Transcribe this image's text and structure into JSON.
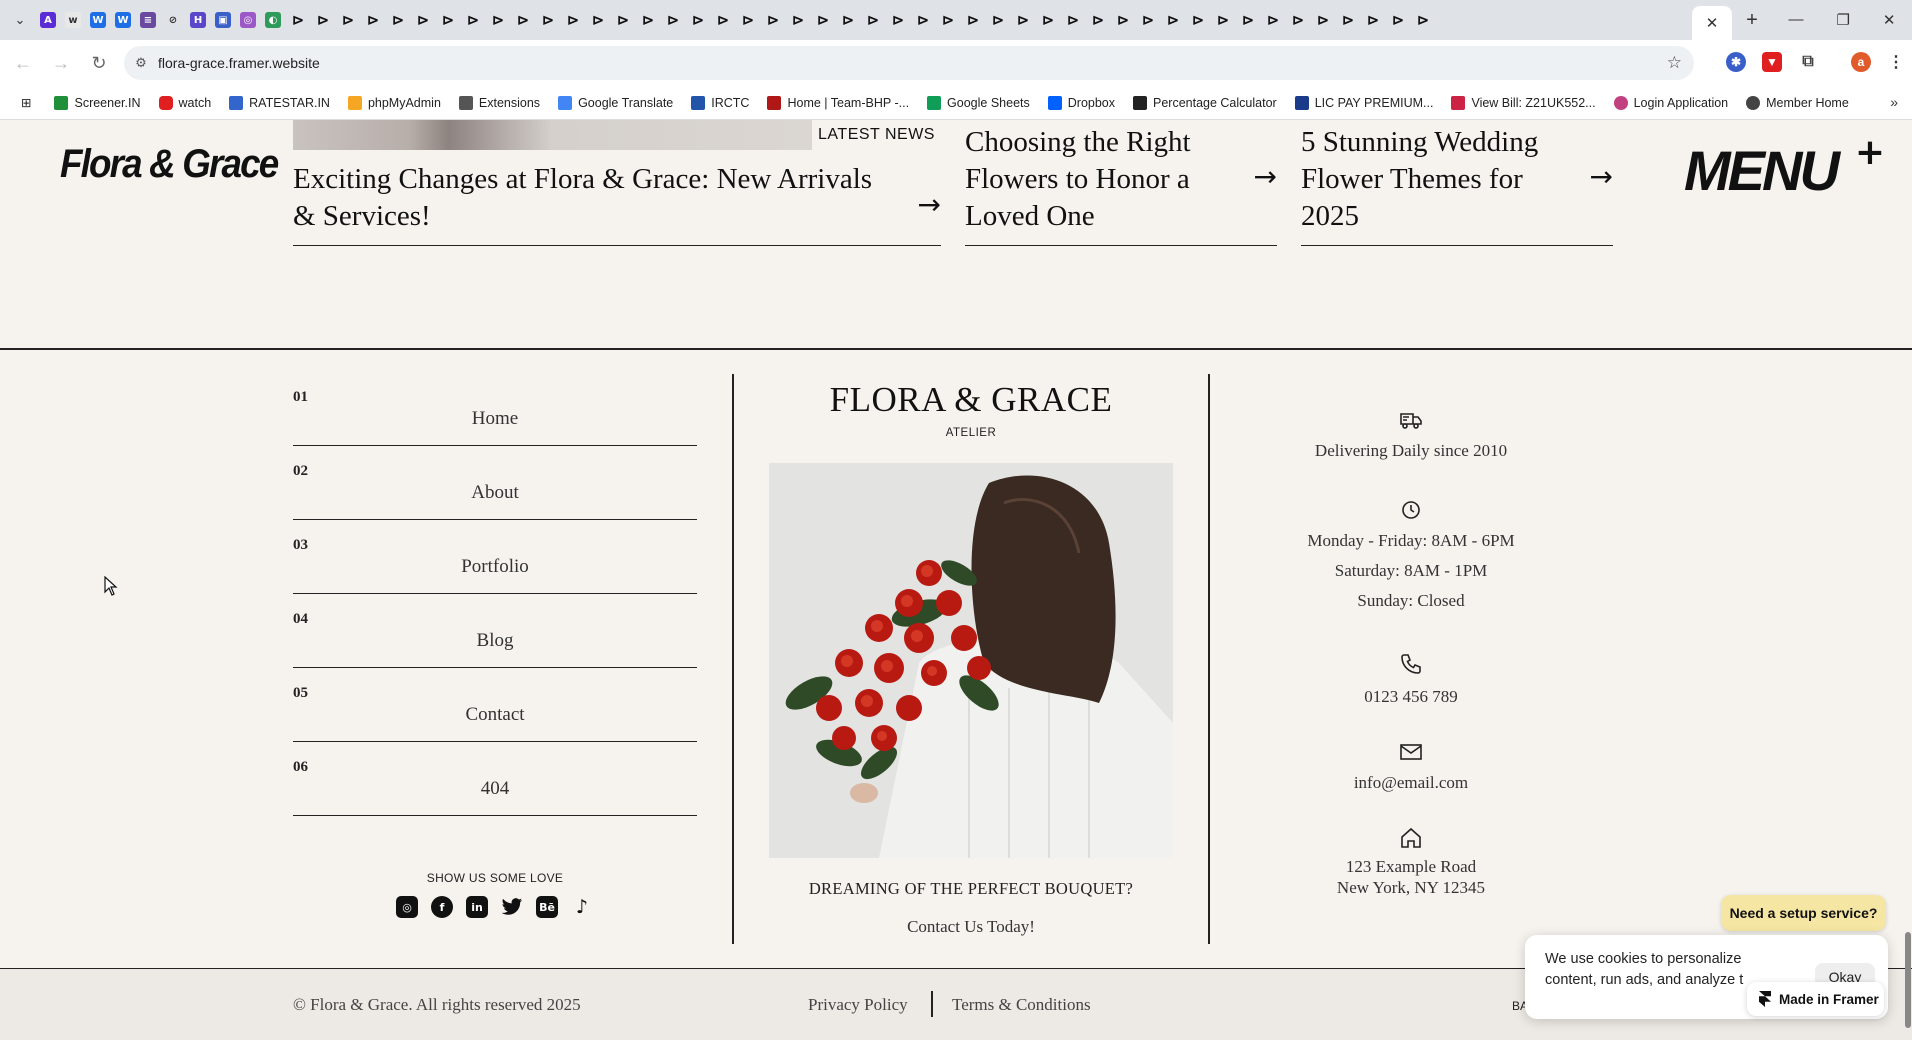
{
  "browser": {
    "active_tab_close": "✕",
    "new_tab": "+",
    "window_controls": [
      "—",
      "❐",
      "✕"
    ],
    "url": "flora-grace.framer.website",
    "profile_initial": "a",
    "bookmarks": [
      {
        "label": "Screener.IN",
        "color": "#1f8f3a"
      },
      {
        "label": "watch",
        "color": "#e02020"
      },
      {
        "label": "RATESTAR.IN",
        "color": "#3366cc"
      },
      {
        "label": "phpMyAdmin",
        "color": "#f5a623"
      },
      {
        "label": "Extensions",
        "color": "#555555"
      },
      {
        "label": "Google Translate",
        "color": "#4285f4"
      },
      {
        "label": "IRCTC",
        "color": "#2255aa"
      },
      {
        "label": "Home | Team-BHP -...",
        "color": "#b01818"
      },
      {
        "label": "Google Sheets",
        "color": "#0f9d58"
      },
      {
        "label": "Dropbox",
        "color": "#0061fe"
      },
      {
        "label": "Percentage Calculator",
        "color": "#222222"
      },
      {
        "label": "LIC PAY PREMIUM...",
        "color": "#1a3a8a"
      },
      {
        "label": "View Bill: Z21UK552...",
        "color": "#cc2244"
      },
      {
        "label": "Login Application",
        "color": "#c04080"
      },
      {
        "label": "Member Home",
        "color": "#444444"
      }
    ],
    "bookmarks_more": "»"
  },
  "header": {
    "logo": "Flora & Grace",
    "menu_label": "MENU",
    "menu_plus": "+"
  },
  "news": {
    "badge": "LATEST NEWS",
    "items": [
      {
        "title": "Exciting Changes at Flora & Grace: New Arrivals & Services!",
        "arrow": "→"
      },
      {
        "title": "Choosing the Right Flowers to Honor a Loved One",
        "arrow": "→"
      },
      {
        "title": "5 Stunning Wedding Flower Themes for 2025",
        "arrow": "→"
      }
    ]
  },
  "footer_nav": {
    "items": [
      {
        "num": "01",
        "label": "Home"
      },
      {
        "num": "02",
        "label": "About"
      },
      {
        "num": "03",
        "label": "Portfolio"
      },
      {
        "num": "04",
        "label": "Blog"
      },
      {
        "num": "05",
        "label": "Contact"
      },
      {
        "num": "06",
        "label": "404"
      }
    ],
    "social_title": "SHOW US SOME LOVE",
    "socials": [
      "instagram-icon",
      "facebook-icon",
      "linkedin-icon",
      "twitter-icon",
      "behance-icon",
      "tiktok-icon"
    ]
  },
  "center": {
    "brand": "FLORA & GRACE",
    "tagline": "ATELIER",
    "cta_heading": "DREAMING OF THE PERFECT BOUQUET?",
    "cta_link": "Contact Us Today!"
  },
  "info": {
    "delivery": "Delivering Daily since 2010",
    "hours": [
      "Monday - Friday: 8AM - 6PM",
      "Saturday: 8AM - 1PM",
      "Sunday: Closed"
    ],
    "phone": "0123 456 789",
    "email": "info@email.com",
    "address": [
      "123 Example Road",
      "New York, NY 12345"
    ]
  },
  "bottom": {
    "copyright": "© Flora & Grace. All rights reserved 2025",
    "privacy": "Privacy Policy",
    "terms": "Terms & Conditions",
    "back_fragment": "BA"
  },
  "overlays": {
    "setup_button": "Need a setup service?",
    "cookie_text_line1": "We use cookies to personalize",
    "cookie_text_line2": "content, run ads, and analyze t",
    "okay": "Okay",
    "made_in_framer": "Made in Framer"
  },
  "colors": {
    "page_bg": "#f6f3ef",
    "footer_bg": "#ede9e4",
    "setup_bg": "#f5e6a3",
    "ink": "#111111"
  }
}
